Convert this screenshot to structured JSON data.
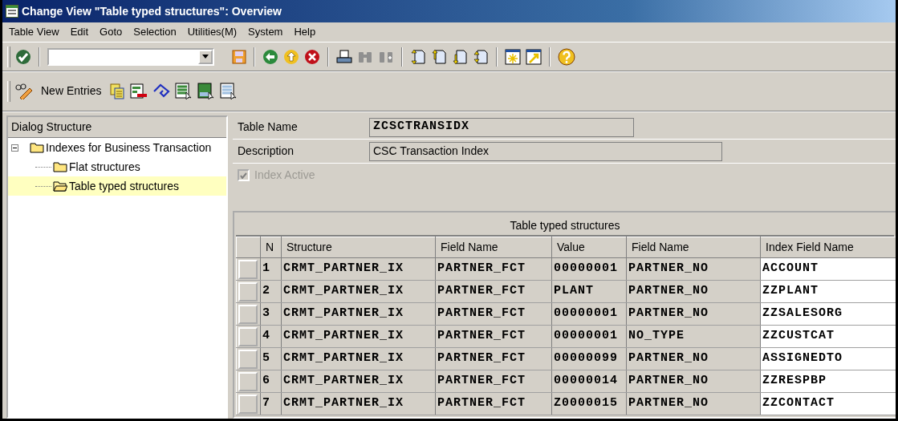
{
  "window": {
    "title": "Change View \"Table typed structures\": Overview"
  },
  "menu": [
    {
      "label": "Table View"
    },
    {
      "label": "Edit"
    },
    {
      "label": "Goto"
    },
    {
      "label": "Selection"
    },
    {
      "label": "Utilities(M)"
    },
    {
      "label": "System"
    },
    {
      "label": "Help"
    }
  ],
  "application_toolbar": {
    "buttons": [
      {
        "label": "New Entries"
      }
    ]
  },
  "dialog_structure": {
    "title": "Dialog Structure",
    "tree": [
      {
        "label": "Indexes for Business Transaction",
        "expanded": true,
        "selected": false,
        "children": [
          {
            "label": "Flat structures",
            "selected": false
          },
          {
            "label": "Table typed structures",
            "selected": true
          }
        ]
      }
    ]
  },
  "header": {
    "fields": [
      {
        "label": "Table Name",
        "value": "ZCSCTRANSIDX"
      },
      {
        "label": "Description",
        "value": "CSC Transaction Index"
      }
    ],
    "index_active": {
      "label": "Index Active",
      "checked": true,
      "disabled": true
    }
  },
  "table": {
    "title": "Table typed structures",
    "columns": [
      {
        "label": "N",
        "kind": "display"
      },
      {
        "label": "Structure",
        "kind": "display"
      },
      {
        "label": "Field Name",
        "kind": "display"
      },
      {
        "label": "Value",
        "kind": "display"
      },
      {
        "label": "Field Name",
        "kind": "display"
      },
      {
        "label": "Index Field Name",
        "kind": "input"
      }
    ],
    "rows": [
      [
        "1",
        "CRMT_PARTNER_IX",
        "PARTNER_FCT",
        "00000001",
        "PARTNER_NO",
        "ACCOUNT"
      ],
      [
        "2",
        "CRMT_PARTNER_IX",
        "PARTNER_FCT",
        "PLANT",
        "PARTNER_NO",
        "ZZPLANT"
      ],
      [
        "3",
        "CRMT_PARTNER_IX",
        "PARTNER_FCT",
        "00000001",
        "PARTNER_NO",
        "ZZSALESORG"
      ],
      [
        "4",
        "CRMT_PARTNER_IX",
        "PARTNER_FCT",
        "00000001",
        "NO_TYPE",
        "ZZCUSTCAT"
      ],
      [
        "5",
        "CRMT_PARTNER_IX",
        "PARTNER_FCT",
        "00000099",
        "PARTNER_NO",
        "ASSIGNEDTO"
      ],
      [
        "6",
        "CRMT_PARTNER_IX",
        "PARTNER_FCT",
        "00000014",
        "PARTNER_NO",
        "ZZRESPBP"
      ],
      [
        "7",
        "CRMT_PARTNER_IX",
        "PARTNER_FCT",
        "Z0000015",
        "PARTNER_NO",
        "ZZCONTACT"
      ]
    ]
  }
}
